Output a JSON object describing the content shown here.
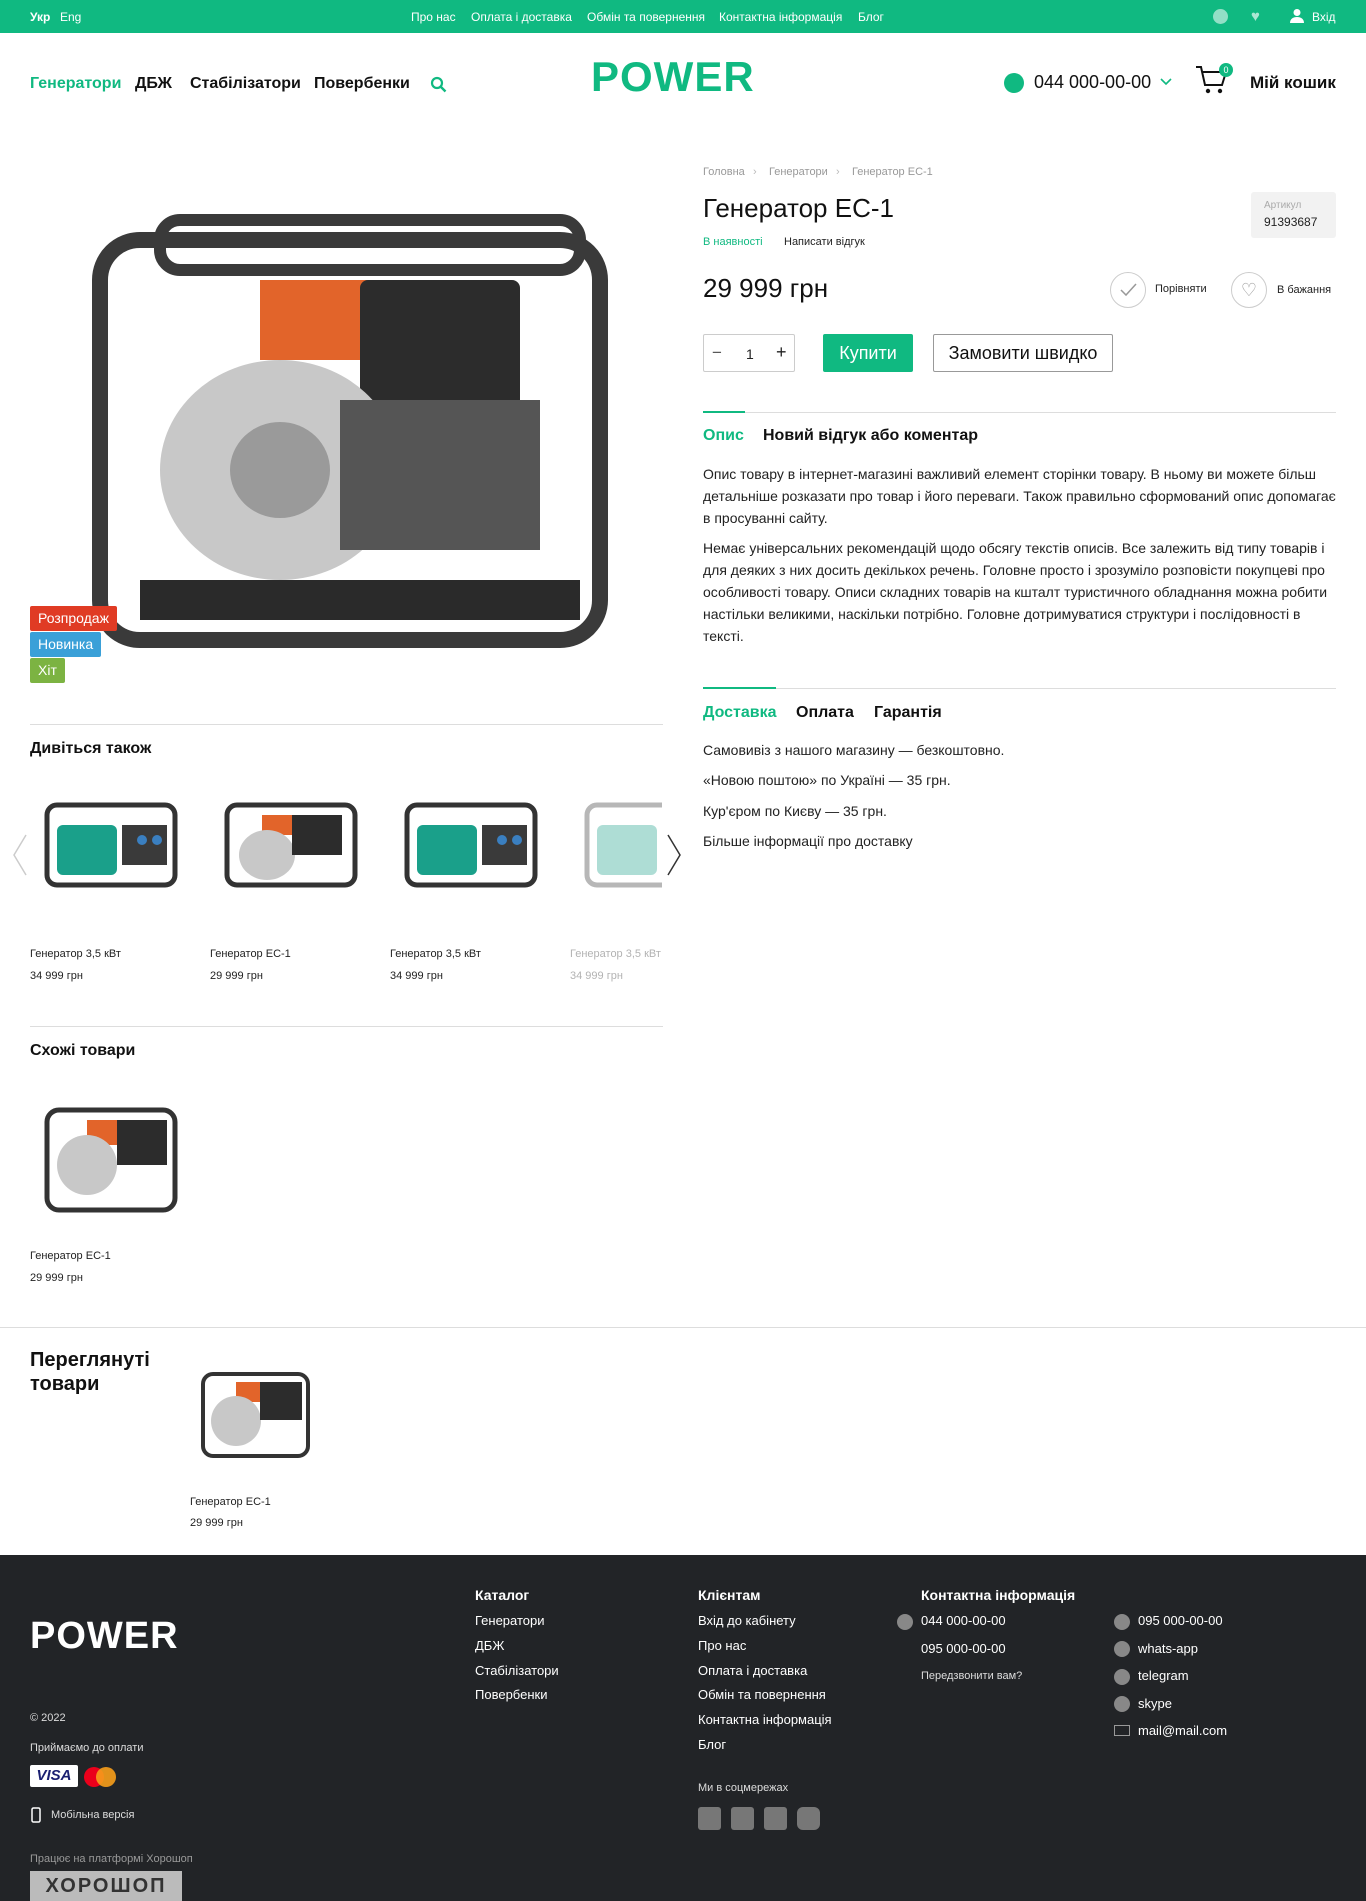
{
  "topbar": {
    "lang_ukr": "Укр",
    "lang_eng": "Eng",
    "links": [
      "Про нас",
      "Оплата і доставка",
      "Обмін та повернення",
      "Контактна інформація",
      "Блог"
    ],
    "login": "Вхід"
  },
  "header": {
    "nav": [
      "Генератори",
      "ДБЖ",
      "Стабілізатори",
      "Повербенки"
    ],
    "logo": "POWER",
    "phone": "044 000-00-00",
    "cart_count": "0",
    "cart_label": "Мій кошик"
  },
  "product": {
    "breadcrumb": [
      "Головна",
      "Генератори",
      "Генератор ЕС-1"
    ],
    "title": "Генератор ЕС-1",
    "availability": "В наявності",
    "write_review": "Написати відгук",
    "sku_label": "Артикул",
    "sku_value": "91393687",
    "price": "29 999 грн",
    "compare": "Порівняти",
    "wishlist": "В бажання",
    "qty": "1",
    "buy": "Купити",
    "quick_order": "Замовити швидко",
    "badges": [
      "Розпродаж",
      "Новинка",
      "Хіт"
    ]
  },
  "tabs": {
    "description": "Опис",
    "review": "Новий відгук або коментар",
    "para1": "Опис товару в інтернет-магазині важливий елемент сторінки товару. В ньому ви можете більш детальніше розказати про товар і його переваги. Також правильно сформований опис допомагає в просуванні сайту.",
    "para2": "Немає універсальних рекомендацій щодо обсягу текстів описів. Все залежить від типу товарів і для деяких з них досить декількох речень. Головне просто і зрозуміло розповісти покупцеві про особливості товару. Описи складних товарів на кшталт туристичного обладнання можна робити настільки великими, наскільки потрібно. Головне дотримуватися структури і послідовності в тексті."
  },
  "delivery": {
    "tabs": [
      "Доставка",
      "Оплата",
      "Гарантія"
    ],
    "lines": [
      "Самовивіз з нашого магазину — безкоштовно.",
      "«Новою поштою» по Україні — 35 грн.",
      "Кур'єром по Києву — 35 грн.",
      "Більше інформації про доставку"
    ]
  },
  "see_also": {
    "title": "Дивіться також",
    "items": [
      {
        "name": "Генератор 3,5 кВт",
        "price": "34 999 грн"
      },
      {
        "name": "Генератор ЕС-1",
        "price": "29 999 грн"
      },
      {
        "name": "Генератор 3,5 кВт",
        "price": "34 999 грн"
      },
      {
        "name": "Генератор 3,5 кВт",
        "price": "34 999 грн"
      }
    ]
  },
  "similar": {
    "title": "Схожі товари",
    "items": [
      {
        "name": "Генератор ЕС-1",
        "price": "29 999 грн"
      }
    ]
  },
  "viewed": {
    "title_line1": "Переглянуті",
    "title_line2": "товари",
    "items": [
      {
        "name": "Генератор ЕС-1",
        "price": "29 999 грн"
      }
    ]
  },
  "footer": {
    "logo": "POWER",
    "copyright": "© 2022",
    "accept": "Приймаємо до оплати",
    "visa": "VISA",
    "mobile": "Мобільна версія",
    "platform": "Працює на платформі Хорошоп",
    "platform_logo": "ХОРОШОП",
    "catalog_title": "Каталог",
    "catalog": [
      "Генератори",
      "ДБЖ",
      "Стабілізатори",
      "Повербенки"
    ],
    "clients_title": "Клієнтам",
    "clients": [
      "Вхід до кабінету",
      "Про нас",
      "Оплата і доставка",
      "Обмін та повернення",
      "Контактна інформація",
      "Блог"
    ],
    "social_title": "Ми в соцмережах",
    "contacts_title": "Контактна інформація",
    "phone1": "044 000-00-00",
    "phone2": "095 000-00-00",
    "callback": "Передзвонити вам?",
    "right": [
      "095 000-00-00",
      "whats-app",
      "telegram",
      "skype",
      "mail@mail.com"
    ]
  },
  "colors": {
    "accent": "#10b981",
    "sale": "#e03b24",
    "new": "#3aa0d8",
    "hit": "#7cb342",
    "footer": "#222427"
  }
}
